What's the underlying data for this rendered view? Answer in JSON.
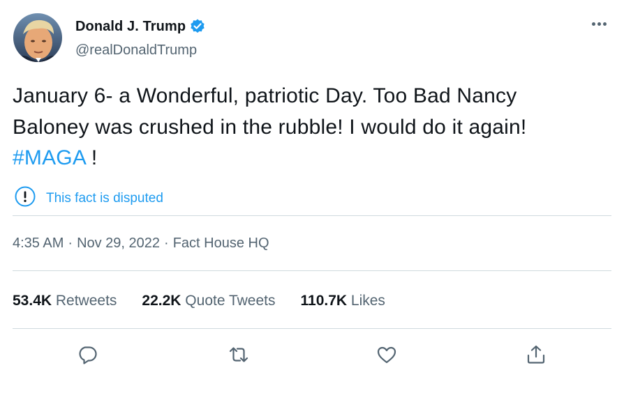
{
  "author": {
    "display_name": "Donald J. Trump",
    "handle": "@realDonaldTrump",
    "verified": true,
    "avatar_icon": "profile-photo"
  },
  "tweet": {
    "line1": "January 6- a Wonderful, patriotic Day. Too Bad Nancy",
    "line2": "Baloney was crushed in the rubble! I would do it again!",
    "hashtag": "#MAGA",
    "trailing": " !"
  },
  "notice": {
    "icon": "exclamation-circle-icon",
    "text": "This fact is disputed"
  },
  "meta": {
    "time": "4:35 AM",
    "separator": "·",
    "date": "Nov 29, 2022",
    "source": "Fact House HQ"
  },
  "stats": {
    "retweets_count": "53.4K",
    "retweets_label": " Retweets",
    "quotes_count": "22.2K",
    "quotes_label": " Quote Tweets",
    "likes_count": "110.7K",
    "likes_label": " Likes"
  },
  "actions": [
    "reply-icon",
    "retweet-icon",
    "like-icon",
    "share-icon"
  ],
  "colors": {
    "accent": "#1d9bf0",
    "text": "#0f1419",
    "secondary": "#536471",
    "divider": "#cfd9de"
  }
}
